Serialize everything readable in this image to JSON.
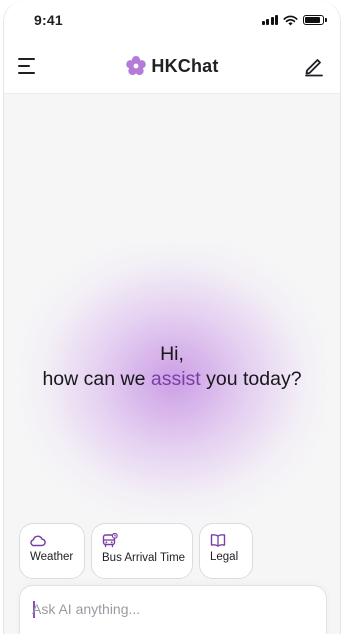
{
  "status_bar": {
    "time": "9:41"
  },
  "header": {
    "app_name": "HKChat"
  },
  "greeting": {
    "line1": "Hi,",
    "line2_before": "how can we ",
    "line2_highlight": "assist",
    "line2_after": " you today?"
  },
  "suggestions": [
    {
      "label": "Weather",
      "icon": "cloud-icon"
    },
    {
      "label": "Bus Arrival Time",
      "icon": "bus-icon"
    },
    {
      "label": "Legal",
      "icon": "book-icon"
    }
  ],
  "composer": {
    "value": "",
    "placeholder": "Ask AI anything..."
  },
  "colors": {
    "brand": "#7a3fa6",
    "logo": "#b57bd8",
    "glow": "#c48ee2"
  }
}
